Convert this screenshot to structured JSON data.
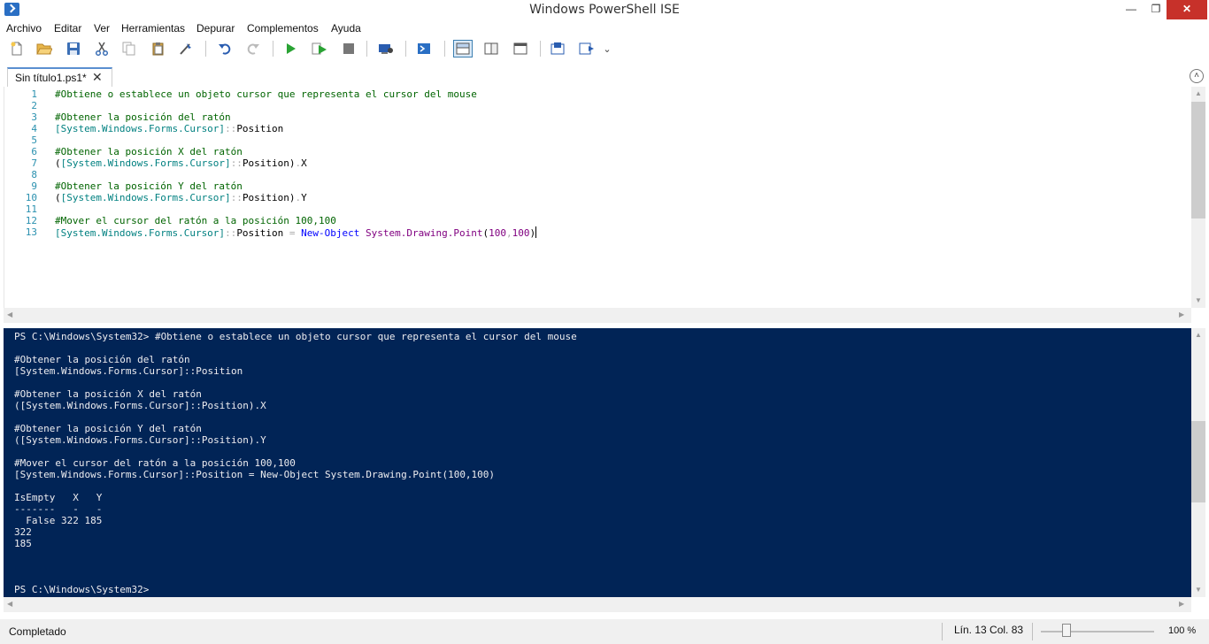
{
  "window": {
    "title": "Windows PowerShell ISE",
    "minimize_glyph": "—",
    "maximize_glyph": "❐",
    "close_glyph": "✕"
  },
  "menubar": {
    "items": [
      "Archivo",
      "Editar",
      "Ver",
      "Herramientas",
      "Depurar",
      "Complementos",
      "Ayuda"
    ]
  },
  "toolbar": {
    "icons": [
      "new-file-icon",
      "open-folder-icon",
      "save-icon",
      "cut-icon",
      "copy-icon",
      "paste-icon",
      "clear-console-icon",
      "undo-icon",
      "redo-icon",
      "run-script-icon",
      "run-selection-icon",
      "stop-icon",
      "remote-powershell-icon",
      "powershell-console-icon",
      "script-pane-top-icon",
      "script-pane-right-icon",
      "script-pane-maximized-icon",
      "show-command-window-icon",
      "show-command-addon-icon"
    ],
    "overflow_glyph": "⌄"
  },
  "tab": {
    "title": "Sin título1.ps1*",
    "close_glyph": "✕",
    "collapse_glyph": "˄"
  },
  "editor": {
    "lines": [
      {
        "n": "1",
        "text": "#Obtiene o establece un objeto cursor que representa el cursor del mouse"
      },
      {
        "n": "2",
        "text": ""
      },
      {
        "n": "3",
        "text": "#Obtener la posición del ratón"
      },
      {
        "n": "4",
        "text": "[System.Windows.Forms.Cursor]::Position"
      },
      {
        "n": "5",
        "text": ""
      },
      {
        "n": "6",
        "text": "#Obtener la posición X del ratón"
      },
      {
        "n": "7",
        "text": "([System.Windows.Forms.Cursor]::Position).X"
      },
      {
        "n": "8",
        "text": ""
      },
      {
        "n": "9",
        "text": "#Obtener la posición Y del ratón"
      },
      {
        "n": "10",
        "text": "([System.Windows.Forms.Cursor]::Position).Y"
      },
      {
        "n": "11",
        "text": ""
      },
      {
        "n": "12",
        "text": "#Mover el cursor del ratón a la posición 100,100"
      },
      {
        "n": "13",
        "text": "[System.Windows.Forms.Cursor]::Position = New-Object System.Drawing.Point(100,100)"
      }
    ]
  },
  "console": {
    "lines": [
      "PS C:\\Windows\\System32> #Obtiene o establece un objeto cursor que representa el cursor del mouse",
      "",
      "#Obtener la posición del ratón",
      "[System.Windows.Forms.Cursor]::Position",
      "",
      "#Obtener la posición X del ratón",
      "([System.Windows.Forms.Cursor]::Position).X",
      "",
      "#Obtener la posición Y del ratón",
      "([System.Windows.Forms.Cursor]::Position).Y",
      "",
      "#Mover el cursor del ratón a la posición 100,100",
      "[System.Windows.Forms.Cursor]::Position = New-Object System.Drawing.Point(100,100)",
      "",
      "IsEmpty   X   Y",
      "-------   -   -",
      "  False 322 185",
      "322",
      "185",
      "",
      "",
      "",
      "PS C:\\Windows\\System32>"
    ]
  },
  "statusbar": {
    "status": "Completado",
    "position": "Lín. 13  Col. 83",
    "zoom": "100 %",
    "zoom_level_fraction": 0.2
  },
  "colors": {
    "console_background": "#012456",
    "console_text": "#eeedf0",
    "editor_comment": "#006400",
    "editor_type": "#008080",
    "editor_command": "#0000ff",
    "editor_number": "#800080",
    "line_number": "#2b91af",
    "close_button": "#c7312a"
  }
}
